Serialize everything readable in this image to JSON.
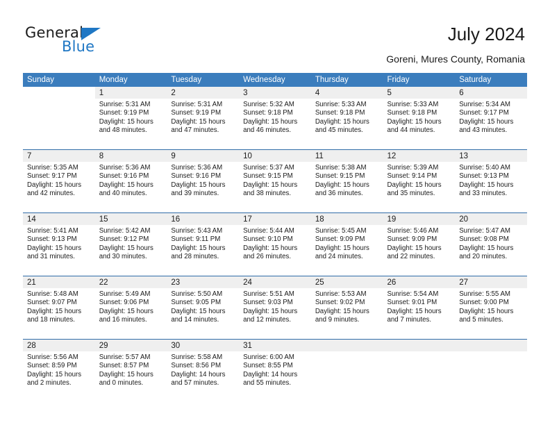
{
  "brand": {
    "name_part1": "General",
    "name_part2": "Blue",
    "accent_color": "#1f77c4",
    "triangle_icon": "triangle-icon"
  },
  "header": {
    "title": "July 2024",
    "subtitle": "Goreni, Mures County, Romania"
  },
  "calendar": {
    "header_bg": "#3b7dbd",
    "daynum_bg": "#efefef",
    "row_separator_color": "#2f6ca8",
    "weekday_headers": [
      "Sunday",
      "Monday",
      "Tuesday",
      "Wednesday",
      "Thursday",
      "Friday",
      "Saturday"
    ],
    "weeks": [
      [
        {
          "day": "",
          "blank": true
        },
        {
          "day": "1",
          "sunrise": "Sunrise: 5:31 AM",
          "sunset": "Sunset: 9:19 PM",
          "daylight": "Daylight: 15 hours and 48 minutes."
        },
        {
          "day": "2",
          "sunrise": "Sunrise: 5:31 AM",
          "sunset": "Sunset: 9:19 PM",
          "daylight": "Daylight: 15 hours and 47 minutes."
        },
        {
          "day": "3",
          "sunrise": "Sunrise: 5:32 AM",
          "sunset": "Sunset: 9:18 PM",
          "daylight": "Daylight: 15 hours and 46 minutes."
        },
        {
          "day": "4",
          "sunrise": "Sunrise: 5:33 AM",
          "sunset": "Sunset: 9:18 PM",
          "daylight": "Daylight: 15 hours and 45 minutes."
        },
        {
          "day": "5",
          "sunrise": "Sunrise: 5:33 AM",
          "sunset": "Sunset: 9:18 PM",
          "daylight": "Daylight: 15 hours and 44 minutes."
        },
        {
          "day": "6",
          "sunrise": "Sunrise: 5:34 AM",
          "sunset": "Sunset: 9:17 PM",
          "daylight": "Daylight: 15 hours and 43 minutes."
        }
      ],
      [
        {
          "day": "7",
          "sunrise": "Sunrise: 5:35 AM",
          "sunset": "Sunset: 9:17 PM",
          "daylight": "Daylight: 15 hours and 42 minutes."
        },
        {
          "day": "8",
          "sunrise": "Sunrise: 5:36 AM",
          "sunset": "Sunset: 9:16 PM",
          "daylight": "Daylight: 15 hours and 40 minutes."
        },
        {
          "day": "9",
          "sunrise": "Sunrise: 5:36 AM",
          "sunset": "Sunset: 9:16 PM",
          "daylight": "Daylight: 15 hours and 39 minutes."
        },
        {
          "day": "10",
          "sunrise": "Sunrise: 5:37 AM",
          "sunset": "Sunset: 9:15 PM",
          "daylight": "Daylight: 15 hours and 38 minutes."
        },
        {
          "day": "11",
          "sunrise": "Sunrise: 5:38 AM",
          "sunset": "Sunset: 9:15 PM",
          "daylight": "Daylight: 15 hours and 36 minutes."
        },
        {
          "day": "12",
          "sunrise": "Sunrise: 5:39 AM",
          "sunset": "Sunset: 9:14 PM",
          "daylight": "Daylight: 15 hours and 35 minutes."
        },
        {
          "day": "13",
          "sunrise": "Sunrise: 5:40 AM",
          "sunset": "Sunset: 9:13 PM",
          "daylight": "Daylight: 15 hours and 33 minutes."
        }
      ],
      [
        {
          "day": "14",
          "sunrise": "Sunrise: 5:41 AM",
          "sunset": "Sunset: 9:13 PM",
          "daylight": "Daylight: 15 hours and 31 minutes."
        },
        {
          "day": "15",
          "sunrise": "Sunrise: 5:42 AM",
          "sunset": "Sunset: 9:12 PM",
          "daylight": "Daylight: 15 hours and 30 minutes."
        },
        {
          "day": "16",
          "sunrise": "Sunrise: 5:43 AM",
          "sunset": "Sunset: 9:11 PM",
          "daylight": "Daylight: 15 hours and 28 minutes."
        },
        {
          "day": "17",
          "sunrise": "Sunrise: 5:44 AM",
          "sunset": "Sunset: 9:10 PM",
          "daylight": "Daylight: 15 hours and 26 minutes."
        },
        {
          "day": "18",
          "sunrise": "Sunrise: 5:45 AM",
          "sunset": "Sunset: 9:09 PM",
          "daylight": "Daylight: 15 hours and 24 minutes."
        },
        {
          "day": "19",
          "sunrise": "Sunrise: 5:46 AM",
          "sunset": "Sunset: 9:09 PM",
          "daylight": "Daylight: 15 hours and 22 minutes."
        },
        {
          "day": "20",
          "sunrise": "Sunrise: 5:47 AM",
          "sunset": "Sunset: 9:08 PM",
          "daylight": "Daylight: 15 hours and 20 minutes."
        }
      ],
      [
        {
          "day": "21",
          "sunrise": "Sunrise: 5:48 AM",
          "sunset": "Sunset: 9:07 PM",
          "daylight": "Daylight: 15 hours and 18 minutes."
        },
        {
          "day": "22",
          "sunrise": "Sunrise: 5:49 AM",
          "sunset": "Sunset: 9:06 PM",
          "daylight": "Daylight: 15 hours and 16 minutes."
        },
        {
          "day": "23",
          "sunrise": "Sunrise: 5:50 AM",
          "sunset": "Sunset: 9:05 PM",
          "daylight": "Daylight: 15 hours and 14 minutes."
        },
        {
          "day": "24",
          "sunrise": "Sunrise: 5:51 AM",
          "sunset": "Sunset: 9:03 PM",
          "daylight": "Daylight: 15 hours and 12 minutes."
        },
        {
          "day": "25",
          "sunrise": "Sunrise: 5:53 AM",
          "sunset": "Sunset: 9:02 PM",
          "daylight": "Daylight: 15 hours and 9 minutes."
        },
        {
          "day": "26",
          "sunrise": "Sunrise: 5:54 AM",
          "sunset": "Sunset: 9:01 PM",
          "daylight": "Daylight: 15 hours and 7 minutes."
        },
        {
          "day": "27",
          "sunrise": "Sunrise: 5:55 AM",
          "sunset": "Sunset: 9:00 PM",
          "daylight": "Daylight: 15 hours and 5 minutes."
        }
      ],
      [
        {
          "day": "28",
          "sunrise": "Sunrise: 5:56 AM",
          "sunset": "Sunset: 8:59 PM",
          "daylight": "Daylight: 15 hours and 2 minutes."
        },
        {
          "day": "29",
          "sunrise": "Sunrise: 5:57 AM",
          "sunset": "Sunset: 8:57 PM",
          "daylight": "Daylight: 15 hours and 0 minutes."
        },
        {
          "day": "30",
          "sunrise": "Sunrise: 5:58 AM",
          "sunset": "Sunset: 8:56 PM",
          "daylight": "Daylight: 14 hours and 57 minutes."
        },
        {
          "day": "31",
          "sunrise": "Sunrise: 6:00 AM",
          "sunset": "Sunset: 8:55 PM",
          "daylight": "Daylight: 14 hours and 55 minutes."
        },
        {
          "day": "",
          "empty": true
        },
        {
          "day": "",
          "empty": true
        },
        {
          "day": "",
          "empty": true
        }
      ]
    ]
  }
}
